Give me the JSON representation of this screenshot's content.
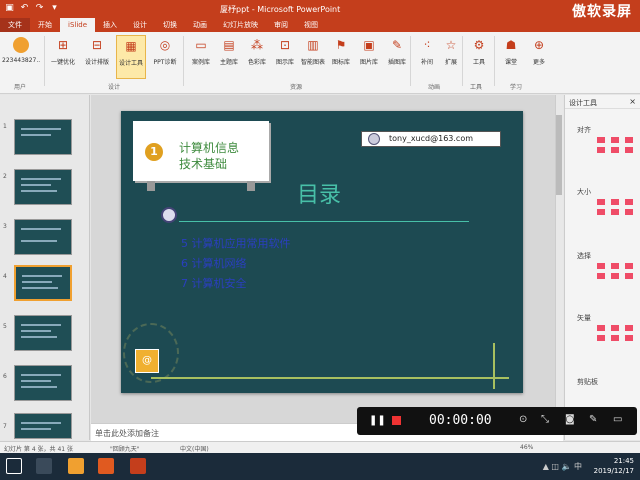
{
  "titlebar": {
    "title": "厦杼ppt - Microsoft PowerPoint",
    "brand": "傲软录屏",
    "qat": [
      "save-icon",
      "undo-icon",
      "redo-icon",
      "customize-icon"
    ]
  },
  "tabs": [
    "文件",
    "开始",
    "iSlide",
    "插入",
    "设计",
    "切换",
    "动画",
    "幻灯片放映",
    "审阅",
    "视图"
  ],
  "active_tab": "iSlide",
  "ribbon": {
    "user_label": "223443827...",
    "buttons": [
      "一键优化",
      "设计排版",
      "设计工具",
      "PPT诊断",
      "案例库",
      "主题库",
      "色彩库",
      "图示库",
      "智能图表",
      "图标库",
      "图片库",
      "插图库",
      "补间",
      "扩展",
      "工具",
      "课堂",
      "更多"
    ],
    "groups": [
      "用户",
      "设计",
      "资源",
      "动画",
      "工具",
      "学习"
    ]
  },
  "thumbnails": {
    "numbers": [
      "1",
      "2",
      "3",
      "4",
      "5",
      "6",
      "7"
    ],
    "selected": "4"
  },
  "slide": {
    "email": "tony_xucd@163.com",
    "card_number": "1",
    "card_line1": "计算机信息",
    "card_line2": "技术基础",
    "heading": "目录",
    "items": [
      "5  计算机应用常用软件",
      "6  计算机网络",
      "7  计算机安全"
    ]
  },
  "notes": {
    "placeholder": "单击此处添加备注"
  },
  "right_pane": {
    "title": "设计工具",
    "sections": [
      "对齐",
      "大小",
      "选择",
      "矢量",
      "剪贴板"
    ]
  },
  "status": {
    "slide_info": "幻灯片 第 4 张，共 41 张",
    "theme": "\"回顾九天\"",
    "language": "中文(中国)",
    "zoom": "46%"
  },
  "recorder": {
    "time": "00:00:00"
  },
  "taskbar": {
    "time": "21:45",
    "date": "2019/12/17"
  }
}
